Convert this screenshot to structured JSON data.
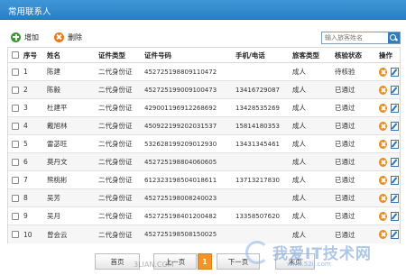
{
  "window": {
    "title": "常用联系人"
  },
  "toolbar": {
    "add_label": "增加",
    "delete_label": "删除"
  },
  "search": {
    "placeholder": "输入旅客姓名"
  },
  "columns": {
    "index": "序号",
    "name": "姓名",
    "cert_type": "证件类型",
    "cert_no": "证件号码",
    "phone": "手机/电话",
    "passenger_type": "旅客类型",
    "check_status": "核验状态",
    "actions": "操作"
  },
  "rows": [
    {
      "index": "1",
      "name": "陈建",
      "cert_type": "二代身份证",
      "cert_no": "452725198809110472",
      "phone": "",
      "passenger_type": "成人",
      "check_status": "待核验"
    },
    {
      "index": "2",
      "name": "陈毅",
      "cert_type": "二代身份证",
      "cert_no": "452725199009100473",
      "phone": "13416729087",
      "passenger_type": "成人",
      "check_status": "已通过"
    },
    {
      "index": "3",
      "name": "杜建平",
      "cert_type": "二代身份证",
      "cert_no": "429001196912268692",
      "phone": "13428535269",
      "passenger_type": "成人",
      "check_status": "已通过"
    },
    {
      "index": "4",
      "name": "戴旭林",
      "cert_type": "二代身份证",
      "cert_no": "450922199202031537",
      "phone": "15814180353",
      "passenger_type": "成人",
      "check_status": "已通过"
    },
    {
      "index": "5",
      "name": "雷苾旺",
      "cert_type": "二代身份证",
      "cert_no": "532628199209012930",
      "phone": "13431345461",
      "passenger_type": "成人",
      "check_status": "已通过"
    },
    {
      "index": "6",
      "name": "莫丹文",
      "cert_type": "二代身份证",
      "cert_no": "452725198804060605",
      "phone": "",
      "passenger_type": "成人",
      "check_status": "已通过"
    },
    {
      "index": "7",
      "name": "熊桃彬",
      "cert_type": "二代身份证",
      "cert_no": "612323198504018611",
      "phone": "13713217830",
      "passenger_type": "成人",
      "check_status": "已通过"
    },
    {
      "index": "8",
      "name": "吴芳",
      "cert_type": "二代身份证",
      "cert_no": "452725198008240023",
      "phone": "",
      "passenger_type": "成人",
      "check_status": "已通过"
    },
    {
      "index": "9",
      "name": "吴月",
      "cert_type": "二代身份证",
      "cert_no": "452725198401200482",
      "phone": "13358507620",
      "passenger_type": "成人",
      "check_status": "已通过"
    },
    {
      "index": "10",
      "name": "曾会云",
      "cert_type": "二代身份证",
      "cert_no": "452725198508150025",
      "phone": "",
      "passenger_type": "成人",
      "check_status": "已通过"
    }
  ],
  "pager": {
    "first": "首页",
    "prev": "上一页",
    "current": "1",
    "next": "下一页",
    "last": "末页"
  },
  "watermark": {
    "big": "我爱IT技术网",
    "small": "www.52ij.com",
    "site": "3LIAN.COM"
  },
  "colors": {
    "title_bar": "#2f86cc",
    "link": "#1a6fc8",
    "pager_current": "#f0952b",
    "delete_icon": "#e58a1c"
  }
}
